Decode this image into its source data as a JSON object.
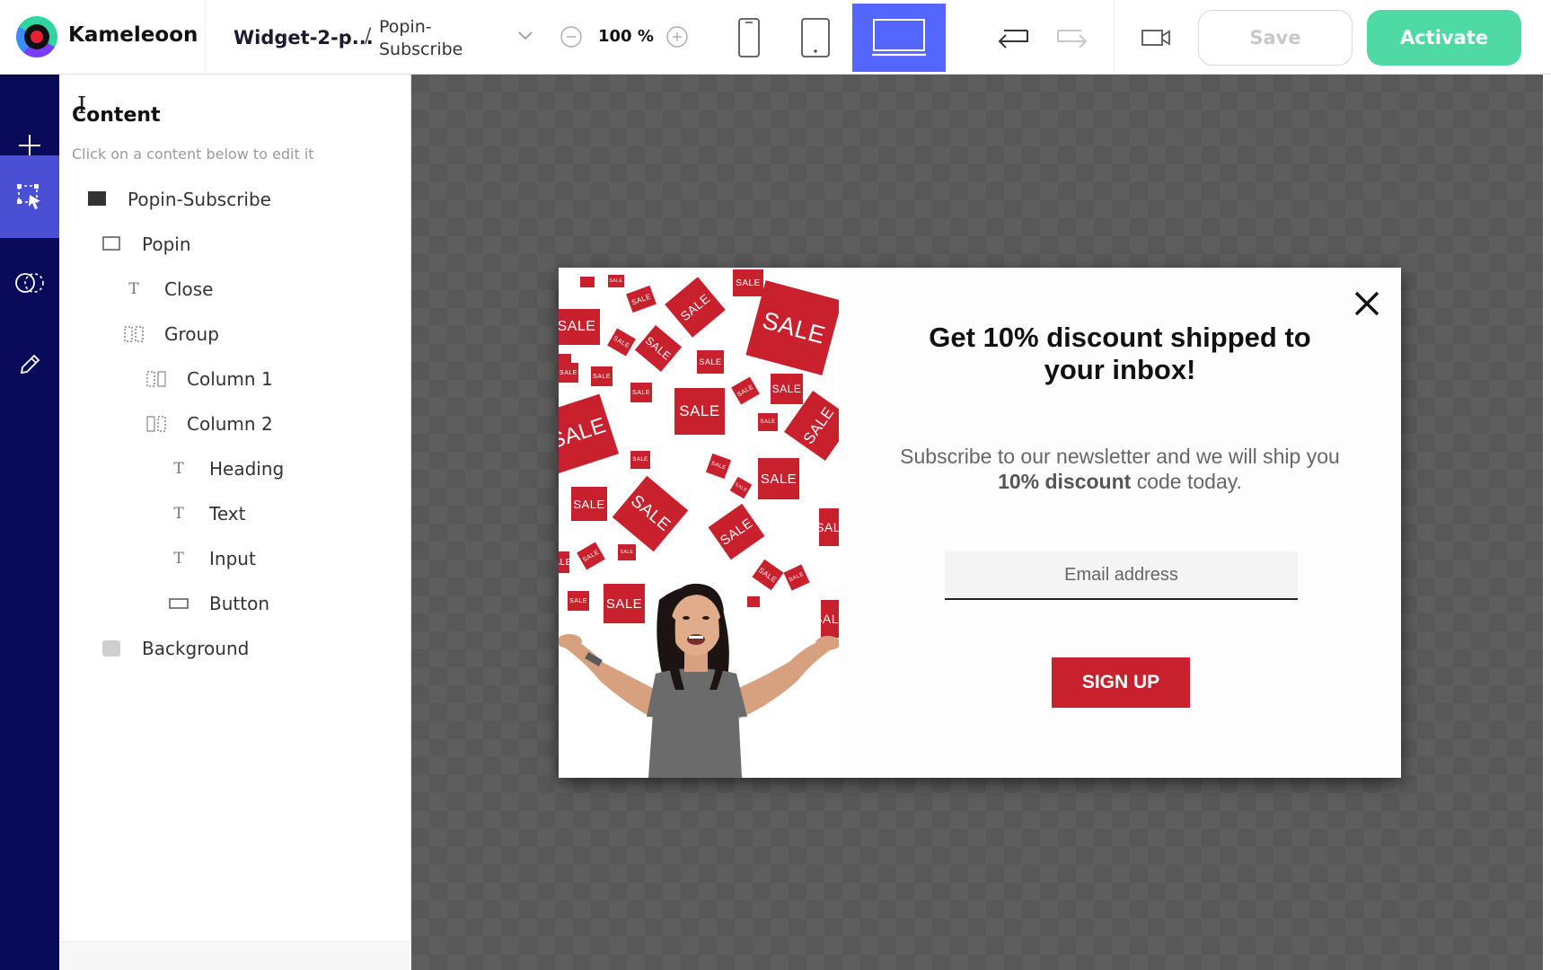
{
  "app": {
    "brand": "Kameleoon"
  },
  "header": {
    "widget_name": "Widget-2-p...",
    "separator": "/",
    "page_name": "Popin-Subscribe",
    "zoom": "100 %",
    "save_label": "Save",
    "activate_label": "Activate",
    "active_device": "desktop"
  },
  "rail": {
    "items": [
      "add",
      "content",
      "targeting",
      "edit"
    ],
    "active": "content"
  },
  "panel": {
    "title": "Content",
    "subtitle": "Click on a content below to edit it",
    "tree": [
      {
        "label": "Popin-Subscribe",
        "icon": "filled-square-icon"
      },
      {
        "label": "Popin",
        "icon": "square-outline-icon"
      },
      {
        "label": "Close",
        "icon": "text-icon"
      },
      {
        "label": "Group",
        "icon": "columns-icon"
      },
      {
        "label": "Column 1",
        "icon": "column-icon"
      },
      {
        "label": "Column 2",
        "icon": "column-icon"
      },
      {
        "label": "Heading",
        "icon": "text-icon"
      },
      {
        "label": "Text",
        "icon": "text-icon"
      },
      {
        "label": "Input",
        "icon": "text-icon"
      },
      {
        "label": "Button",
        "icon": "button-icon"
      },
      {
        "label": "Background",
        "icon": "background-swatch-icon"
      }
    ]
  },
  "popin": {
    "heading": "Get 10% discount shipped to your inbox!",
    "text_before": "Subscribe to our newsletter and we will ship you ",
    "text_bold": "10% discount",
    "text_after": " code today.",
    "input_placeholder": "Email address",
    "button_label": "SIGN UP",
    "tag_text": "SALE"
  },
  "colors": {
    "rail": "#0a0a5a",
    "rail_active": "#4a4fd4",
    "device_active": "#5566ff",
    "activate": "#4fd9a4",
    "sale_red": "#c8202c",
    "canvas": "#585858"
  }
}
